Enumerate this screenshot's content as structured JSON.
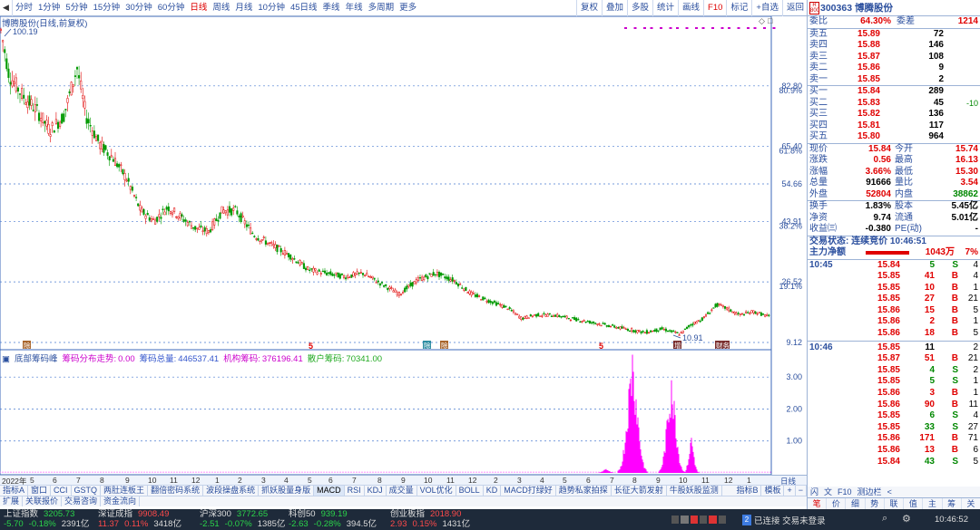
{
  "topbar": {
    "periods": [
      "分时",
      "1分钟",
      "5分钟",
      "15分钟",
      "30分钟",
      "60分钟",
      "日线",
      "周线",
      "月线",
      "10分钟",
      "45日线",
      "季线",
      "年线",
      "多周期",
      "更多"
    ],
    "active_period": "日线",
    "tools": [
      "复权",
      "叠加",
      "多股",
      "统计",
      "画线",
      "F10",
      "标记",
      "+自选",
      "返回"
    ]
  },
  "chart": {
    "title": "博腾股份(日线,前复权)",
    "price_labels": [
      "82.80",
      "65.40",
      "54.66",
      "43.91",
      "26.52",
      "9.12"
    ],
    "pct_labels": [
      "80.9%",
      "61.8%",
      "38.2%",
      "19.1%"
    ],
    "max_label": "100.19",
    "min_label": "10.91",
    "event_markers": [
      "除",
      "5",
      "除",
      "除",
      "5",
      "增",
      "财务"
    ],
    "indicator_legend": {
      "name": "底部筹码峰",
      "items": [
        {
          "label": "筹码分布走势:",
          "value": "0.00",
          "color": "#cc00cc"
        },
        {
          "label": "筹码总量:",
          "value": "446537.41",
          "color": "#3355cc"
        },
        {
          "label": "机构筹码:",
          "value": "376196.41",
          "color": "#cc00cc"
        },
        {
          "label": "散户筹码:",
          "value": "70341.00",
          "color": "#22aa22"
        }
      ]
    },
    "indicator_axis": [
      "3.00",
      "2.00",
      "1.00"
    ],
    "x_labels": [
      "2022年",
      "5",
      "6",
      "7",
      "8",
      "9",
      "10",
      "11",
      "12",
      "1",
      "2",
      "3",
      "4",
      "5",
      "6",
      "7",
      "8",
      "9",
      "10",
      "11",
      "12",
      "2",
      "3",
      "4",
      "5",
      "6",
      "7",
      "8",
      "9",
      "10",
      "11",
      "12",
      "1"
    ],
    "x_suffix": "日线"
  },
  "chart_data": {
    "type": "candlestick",
    "title": "博腾股份(日线,前复权)",
    "series": [
      {
        "name": "close",
        "approx_path": [
          [
            0,
            100.19
          ],
          [
            10,
            86
          ],
          [
            25,
            80
          ],
          [
            40,
            76
          ],
          [
            55,
            70
          ],
          [
            70,
            74
          ],
          [
            85,
            88
          ],
          [
            95,
            74
          ],
          [
            110,
            66
          ],
          [
            125,
            62
          ],
          [
            140,
            56
          ],
          [
            155,
            47
          ],
          [
            170,
            44
          ],
          [
            185,
            48
          ],
          [
            200,
            45
          ],
          [
            215,
            42
          ],
          [
            230,
            41
          ],
          [
            245,
            47
          ],
          [
            260,
            47
          ],
          [
            280,
            40
          ],
          [
            300,
            37
          ],
          [
            320,
            34
          ],
          [
            340,
            30
          ],
          [
            360,
            29
          ],
          [
            380,
            28
          ],
          [
            400,
            29
          ],
          [
            420,
            26
          ],
          [
            440,
            23
          ],
          [
            460,
            27
          ],
          [
            480,
            29
          ],
          [
            500,
            27
          ],
          [
            520,
            23
          ],
          [
            540,
            21
          ],
          [
            560,
            19
          ],
          [
            575,
            16
          ],
          [
            590,
            17
          ],
          [
            610,
            17
          ],
          [
            630,
            16
          ],
          [
            650,
            15
          ],
          [
            670,
            14
          ],
          [
            690,
            13
          ],
          [
            710,
            12
          ],
          [
            730,
            13
          ],
          [
            750,
            11.5
          ],
          [
            760,
            14
          ],
          [
            775,
            16
          ],
          [
            790,
            20
          ],
          [
            800,
            19
          ],
          [
            815,
            17
          ],
          [
            830,
            18
          ],
          [
            848,
            16.5
          ]
        ]
      }
    ],
    "ylim": [
      9.12,
      100.19
    ],
    "indicator": {
      "name": "底部筹码峰",
      "ylim": [
        0,
        3.8
      ],
      "peaks": [
        {
          "x": 697,
          "value": 3.7
        },
        {
          "x": 740,
          "value": 2.9
        }
      ]
    }
  },
  "right_panel": {
    "code": "300363",
    "name": "博腾股份",
    "badge": "R\n800",
    "wei_bi": {
      "label": "委比",
      "value": "64.30%",
      "label2": "委差",
      "value2": "1214"
    },
    "asks": [
      {
        "label": "卖五",
        "price": "15.89",
        "vol": "72"
      },
      {
        "label": "卖四",
        "price": "15.88",
        "vol": "146"
      },
      {
        "label": "卖三",
        "price": "15.87",
        "vol": "108"
      },
      {
        "label": "卖二",
        "price": "15.86",
        "vol": "9"
      },
      {
        "label": "卖一",
        "price": "15.85",
        "vol": "2"
      }
    ],
    "bids": [
      {
        "label": "买一",
        "price": "15.84",
        "vol": "289",
        "chg": ""
      },
      {
        "label": "买二",
        "price": "15.83",
        "vol": "45",
        "chg": "-10"
      },
      {
        "label": "买三",
        "price": "15.82",
        "vol": "136",
        "chg": ""
      },
      {
        "label": "买四",
        "price": "15.81",
        "vol": "117",
        "chg": ""
      },
      {
        "label": "买五",
        "price": "15.80",
        "vol": "964",
        "chg": ""
      }
    ],
    "quote": [
      {
        "l1": "现价",
        "v1": "15.84",
        "l2": "今开",
        "v2": "15.74"
      },
      {
        "l1": "涨跌",
        "v1": "0.56",
        "l2": "最高",
        "v2": "16.13"
      },
      {
        "l1": "涨幅",
        "v1": "3.66%",
        "l2": "最低",
        "v2": "15.30"
      },
      {
        "l1": "总量",
        "v1": "91666",
        "l2": "量比",
        "v2": "3.54"
      },
      {
        "l1": "外盘",
        "v1": "52804",
        "l2": "内盘",
        "v2": "38862"
      }
    ],
    "quote2": [
      {
        "l1": "换手",
        "v1": "1.83%",
        "l2": "股本",
        "v2": "5.45亿"
      },
      {
        "l1": "净资",
        "v1": "9.74",
        "l2": "流通",
        "v2": "5.01亿"
      },
      {
        "l1": "收益㈢",
        "v1": "-0.380",
        "l2": "PE(动)",
        "v2": "-"
      }
    ],
    "trade_status": "交易状态: 连续竞价 10:46:51",
    "main_flow": {
      "label": "主力净额",
      "value": "1043万",
      "pct": "7%"
    },
    "ticks": [
      {
        "t": "10:45",
        "p": "15.84",
        "v": "5",
        "s": "S",
        "n": "4"
      },
      {
        "t": "",
        "p": "15.85",
        "v": "41",
        "s": "B",
        "n": "4"
      },
      {
        "t": "",
        "p": "15.85",
        "v": "10",
        "s": "B",
        "n": "1"
      },
      {
        "t": "",
        "p": "15.85",
        "v": "27",
        "s": "B",
        "n": "21"
      },
      {
        "t": "",
        "p": "15.86",
        "v": "15",
        "s": "B",
        "n": "5"
      },
      {
        "t": "",
        "p": "15.86",
        "v": "2",
        "s": "B",
        "n": "1"
      },
      {
        "t": "",
        "p": "15.86",
        "v": "18",
        "s": "B",
        "n": "5"
      },
      {
        "t": "10:46",
        "p": "15.85",
        "v": "11",
        "s": "",
        "n": "2"
      },
      {
        "t": "",
        "p": "15.87",
        "v": "51",
        "s": "B",
        "n": "21"
      },
      {
        "t": "",
        "p": "15.85",
        "v": "4",
        "s": "S",
        "n": "2"
      },
      {
        "t": "",
        "p": "15.85",
        "v": "5",
        "s": "S",
        "n": "1"
      },
      {
        "t": "",
        "p": "15.86",
        "v": "3",
        "s": "B",
        "n": "1"
      },
      {
        "t": "",
        "p": "15.86",
        "v": "90",
        "s": "B",
        "n": "11"
      },
      {
        "t": "",
        "p": "15.85",
        "v": "6",
        "s": "S",
        "n": "4"
      },
      {
        "t": "",
        "p": "15.85",
        "v": "33",
        "s": "S",
        "n": "27"
      },
      {
        "t": "",
        "p": "15.86",
        "v": "171",
        "s": "B",
        "n": "71"
      },
      {
        "t": "",
        "p": "15.86",
        "v": "13",
        "s": "B",
        "n": "6"
      },
      {
        "t": "",
        "p": "15.84",
        "v": "43",
        "s": "S",
        "n": "5"
      }
    ],
    "tabs_row2": [
      "闪",
      "文",
      "F10",
      "测边栏",
      "<"
    ],
    "tabs": [
      "笔",
      "价",
      "细",
      "势",
      "联",
      "值",
      "主",
      "筹",
      "关"
    ]
  },
  "indicator_bar1": [
    "指标A",
    "窗口",
    "CCI",
    "GSTQ",
    "两肚连板王",
    "翻倍密码系统",
    "波段操盘系统",
    "抓妖股量身版",
    "MACD",
    "RSI",
    "KDJ",
    "成交量",
    "VOL优化",
    "BOLL",
    "KD",
    "MACD打绿好",
    "趋势私家拍探",
    "长征大箭发射",
    "牛股妖股监测"
  ],
  "indicator_bar1_right": [
    "指标B",
    "模板"
  ],
  "indicator_bar2": [
    "扩展",
    "关联报价",
    "交易咨询",
    "资金流向"
  ],
  "status_bar": {
    "indices": [
      {
        "name": "上证指数",
        "value": "3205.73",
        "chg": "-5.70",
        "pct": "-0.18%",
        "amt": "2391亿",
        "dir": "down"
      },
      {
        "name": "深证成指",
        "value": "9908.49",
        "chg": "11.37",
        "pct": "0.11%",
        "amt": "3418亿",
        "dir": "up"
      },
      {
        "name": "沪深300",
        "value": "3772.65",
        "chg": "-2.51",
        "pct": "-0.07%",
        "amt": "1385亿",
        "dir": "down"
      },
      {
        "name": "科创50",
        "value": "939.19",
        "chg": "-2.63",
        "pct": "-0.28%",
        "amt": "394.5亿",
        "dir": "down"
      },
      {
        "name": "创业板指",
        "value": "2018.90",
        "chg": "2.93",
        "pct": "0.15%",
        "amt": "1431亿",
        "dir": "up"
      }
    ],
    "connection": "已连接 交易未登录",
    "conn_num": "2",
    "time": "10:46:52"
  }
}
